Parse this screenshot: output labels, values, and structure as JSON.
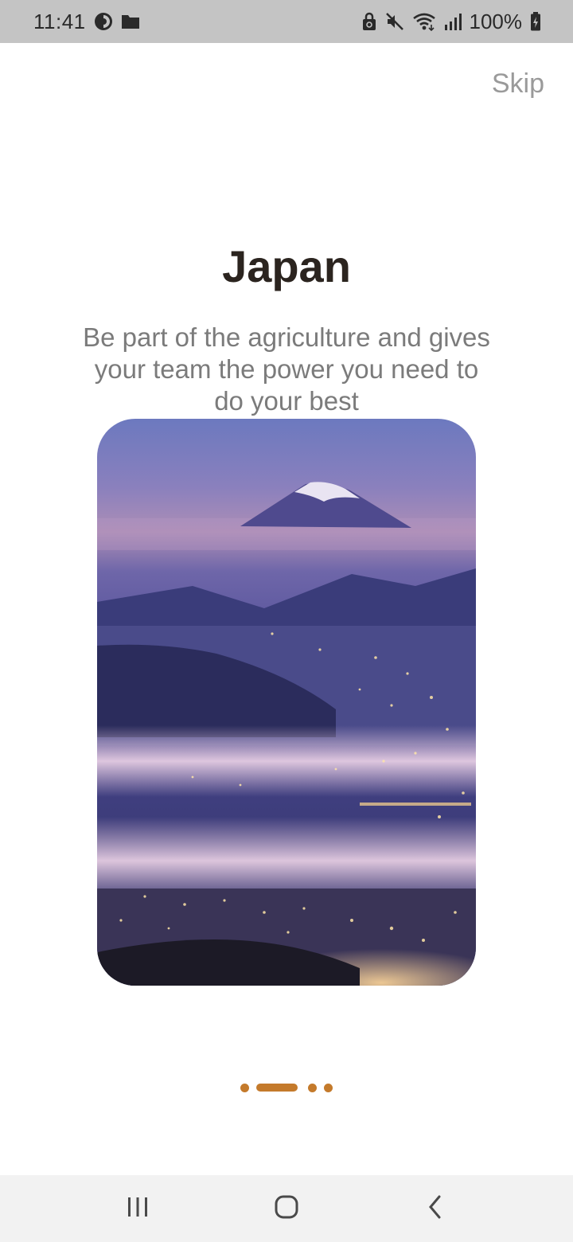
{
  "status_bar": {
    "time": "11:41",
    "battery": "100%",
    "icons": [
      "app-notification-icon",
      "folder-icon",
      "sync-lock-icon",
      "mute-icon",
      "wifi-icon",
      "signal-icon",
      "battery-charging-icon"
    ]
  },
  "onboarding": {
    "skip_label": "Skip",
    "title": "Japan",
    "description": "Be part of the agriculture and gives\nyour team the  power you need to\ndo your best",
    "image_alt": "Mount Fuji above a misty city at night",
    "page_count": 4,
    "active_page": 1
  },
  "navigation_bar": {
    "buttons": [
      "recent-apps-icon",
      "home-icon",
      "back-icon"
    ]
  },
  "colors": {
    "accent": "#c47a2b",
    "title": "#2b241f",
    "body_text": "#7b7b7b",
    "skip": "#9a9a9a",
    "status_bar": "#c4c4c4",
    "nav_bar": "#f2f2f2"
  }
}
